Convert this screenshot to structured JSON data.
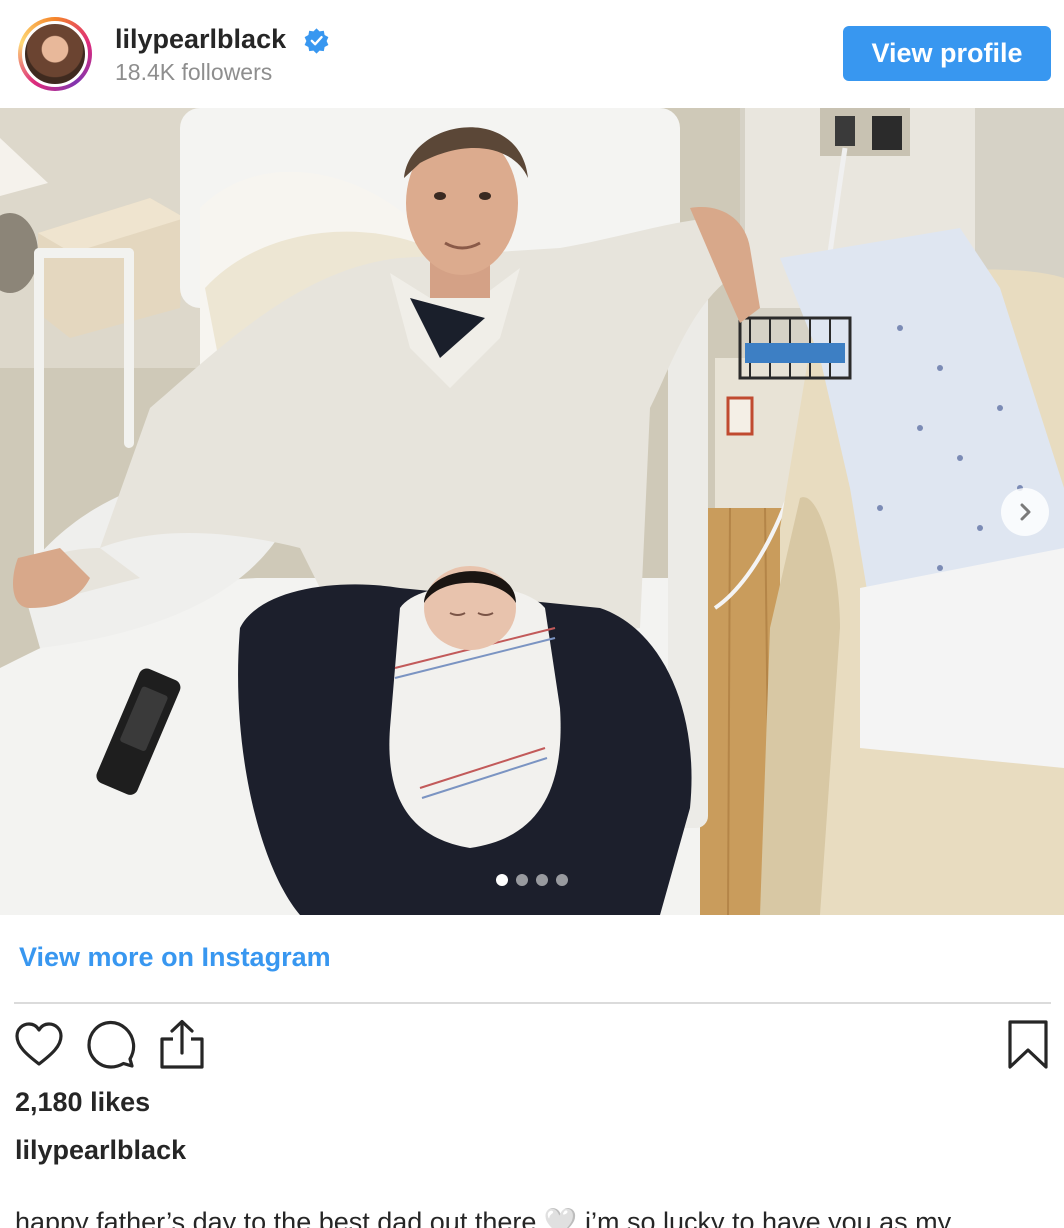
{
  "header": {
    "username": "lilypearlblack",
    "followers": "18.4K followers",
    "view_profile_label": "View profile",
    "verified_icon": "verified-badge-icon"
  },
  "post": {
    "image_alt": "Photo of a man sitting on a hospital bed holding a newborn baby",
    "carousel": {
      "total": 4,
      "current": 1
    },
    "view_more_label": "View more on Instagram",
    "likes": "2,180 likes",
    "caption_username": "lilypearlblack",
    "caption_text": "happy father’s day to the best dad out there 🤍 i’m so lucky to have you as my"
  },
  "icons": {
    "like": "heart-icon",
    "comment": "comment-icon",
    "share": "share-icon",
    "save": "bookmark-icon",
    "next": "chevron-right-icon"
  },
  "colors": {
    "accent": "#3897f0",
    "text": "#262626",
    "muted": "#8e8e8e"
  }
}
